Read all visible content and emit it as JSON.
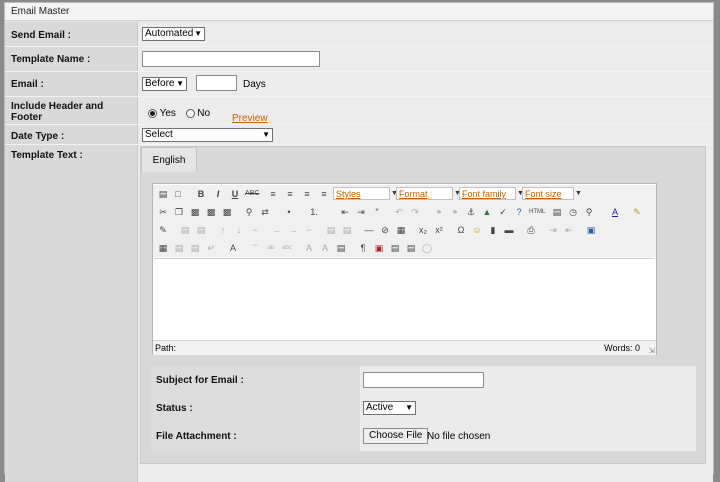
{
  "title": "Email Master",
  "labels": {
    "send_email": "Send Email :",
    "template_name": "Template Name :",
    "email": "Email :",
    "include_hf": "Include Header and Footer",
    "date_type": "Date Type :",
    "template_text": "Template Text :",
    "subject": "Subject for Email :",
    "status": "Status :",
    "file_attachment": "File Attachment :"
  },
  "send_email_value": "Automated",
  "email_when": "Before",
  "days_label": "Days",
  "include_hf_options": {
    "yes": "Yes",
    "no": "No",
    "selected": "Yes"
  },
  "preview_link": "Preview",
  "date_type_value": "Select",
  "tab_label": "English",
  "editor": {
    "styles": "Styles",
    "format": "Format",
    "font_family": "Font family",
    "font_size": "Font size",
    "path_label": "Path:",
    "words_label": "Words: 0"
  },
  "status_value": "Active",
  "choose_file_label": "Choose File",
  "no_file_label": "No file chosen"
}
